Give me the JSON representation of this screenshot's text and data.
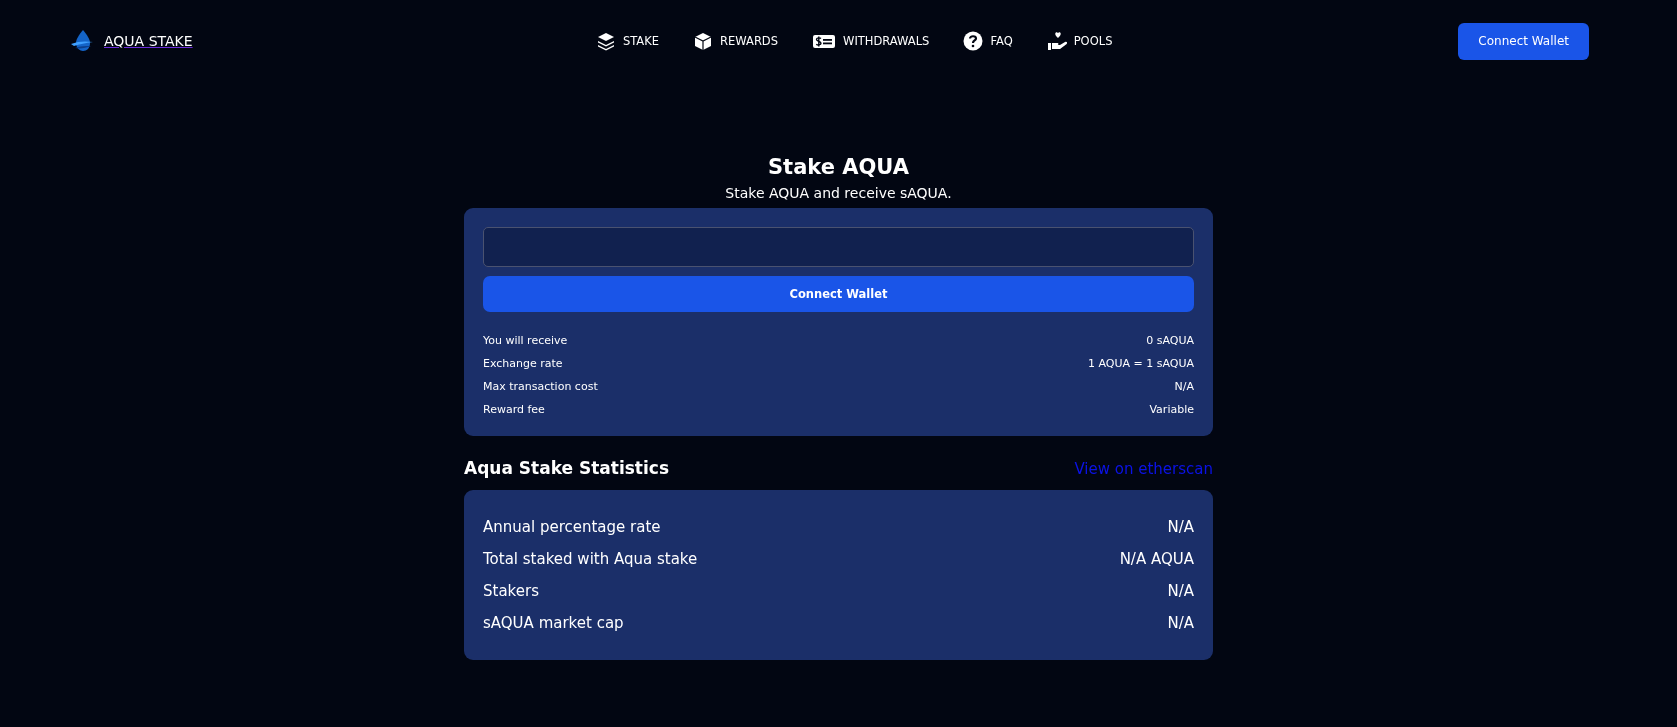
{
  "brand": {
    "name": "AQUA STAKE"
  },
  "nav": [
    {
      "label": "STAKE"
    },
    {
      "label": "REWARDS"
    },
    {
      "label": "WITHDRAWALS"
    },
    {
      "label": "FAQ"
    },
    {
      "label": "POOLS"
    }
  ],
  "header_button": "Connect Wallet",
  "stake": {
    "title": "Stake AQUA",
    "subtitle": "Stake AQUA and receive sAQUA.",
    "button": "Connect Wallet",
    "details": [
      {
        "label": "You will receive",
        "value": "0 sAQUA"
      },
      {
        "label": "Exchange rate",
        "value": "1 AQUA = 1 sAQUA"
      },
      {
        "label": "Max transaction cost",
        "value": "N/A"
      },
      {
        "label": "Reward fee",
        "value": "Variable"
      }
    ]
  },
  "statistics": {
    "title": "Aqua Stake Statistics",
    "link": "View on etherscan",
    "rows": [
      {
        "label": "Annual percentage rate",
        "value": "N/A"
      },
      {
        "label": "Total staked with Aqua stake",
        "value": "N/A AQUA"
      },
      {
        "label": "Stakers",
        "value": "N/A"
      },
      {
        "label": "sAQUA market cap",
        "value": "N/A"
      }
    ]
  }
}
